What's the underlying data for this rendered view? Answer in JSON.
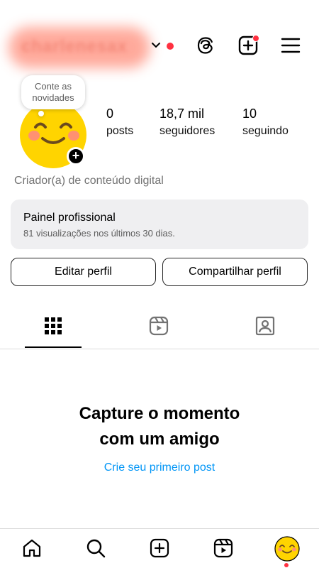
{
  "header": {
    "username": "charlenesax",
    "icons": [
      "chevron-down-icon",
      "threads-icon",
      "add-post-icon",
      "menu-icon"
    ],
    "notification_color": "#ff3040"
  },
  "profile": {
    "note_bubble": "Conte as novidades",
    "stats": [
      {
        "value": "0",
        "label": "posts"
      },
      {
        "value": "18,7 mil",
        "label": "seguidores"
      },
      {
        "value": "10",
        "label": "seguindo"
      }
    ],
    "category": "Criador(a) de conteúdo digital"
  },
  "professional_panel": {
    "title": "Painel profissional",
    "subtitle": "81 visualizações nos últimos 30 dias."
  },
  "actions": {
    "edit": "Editar perfil",
    "share": "Compartilhar perfil"
  },
  "tabs": [
    "grid-icon",
    "reels-icon",
    "tagged-icon"
  ],
  "empty_state": {
    "title": "Capture o momento com um amigo",
    "link": "Crie seu primeiro post",
    "link_color": "#0095f6"
  },
  "bottom_nav": [
    "home-icon",
    "search-icon",
    "create-icon",
    "reels-icon",
    "profile-avatar"
  ]
}
